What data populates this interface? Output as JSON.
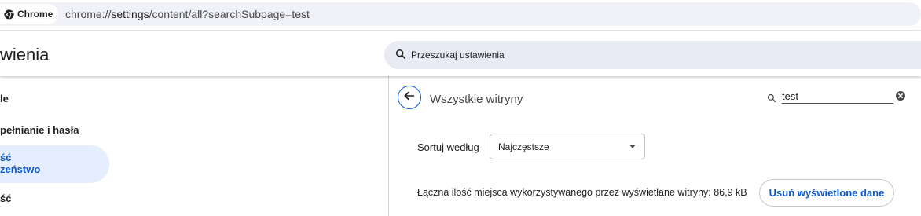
{
  "browser": {
    "chip_label": "Chrome",
    "chip_icon": "chrome-logo-icon",
    "url_prefix": "chrome://",
    "url_host": "settings",
    "url_path": "/content/all?searchSubpage=test"
  },
  "header": {
    "title": "wienia",
    "search_placeholder": "Przeszukaj ustawienia",
    "search_icon": "search-icon"
  },
  "sidebar": {
    "items": [
      {
        "label": "le"
      },
      {
        "label": "pełnianie i hasła"
      },
      {
        "label_line1": "ść",
        "label_line2": "zeństwo"
      },
      {
        "label": "ść"
      }
    ]
  },
  "main": {
    "back_icon": "back-arrow-icon",
    "title": "Wszystkie witryny",
    "site_search_value": "test",
    "sort_label": "Sortuj według",
    "sort_selected": "Najczęstsze",
    "storage_text": "Łączna ilość miejsca wykorzystywanego przez wyświetlane witryny: 86,9 kB",
    "clear_button_label": "Usuń wyświetlone dane"
  },
  "colors": {
    "accent": "#0b57d0",
    "active_nav_bg": "#d3e3fd",
    "search_bg": "#e8ebf3"
  }
}
